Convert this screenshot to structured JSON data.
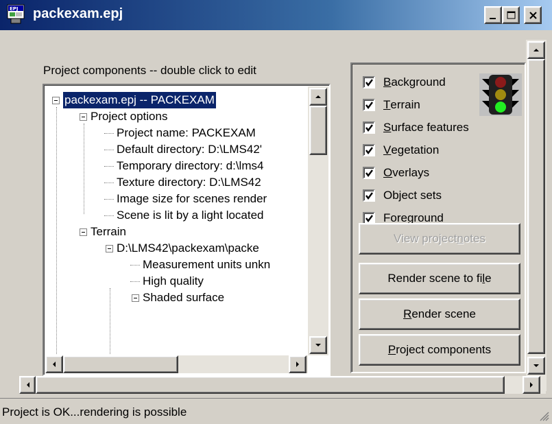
{
  "window": {
    "title": "packexam.epj",
    "icon": "epj-document-icon"
  },
  "tree": {
    "caption": "Project components -- double click to edit",
    "nodes": [
      {
        "label": "packexam.epj -- PACKEXAM",
        "level": 0,
        "expanded": true,
        "selected": true
      },
      {
        "label": "Project options",
        "level": 1,
        "expanded": true
      },
      {
        "label": "Project name: PACKEXAM",
        "level": 2
      },
      {
        "label": "Default directory: D:\\LMS42'",
        "level": 2
      },
      {
        "label": "Temporary directory: d:\\lms4",
        "level": 2
      },
      {
        "label": "Texture directory: D:\\LMS42",
        "level": 2
      },
      {
        "label": "Image size for scenes render",
        "level": 2
      },
      {
        "label": "Scene is lit by a light located",
        "level": 2
      },
      {
        "label": "Terrain",
        "level": 1,
        "expanded": true
      },
      {
        "label": "D:\\LMS42\\packexam\\packe",
        "level": 2,
        "expanded": true
      },
      {
        "label": "Measurement units unkn",
        "level": 3
      },
      {
        "label": "High quality",
        "level": 3
      },
      {
        "label": "Shaded surface",
        "level": 3,
        "expanded": true
      }
    ]
  },
  "layers": {
    "items": [
      {
        "pre": "",
        "accel": "B",
        "post": "ackground",
        "checked": true
      },
      {
        "pre": "",
        "accel": "T",
        "post": "errain",
        "checked": true
      },
      {
        "pre": "",
        "accel": "S",
        "post": "urface features",
        "checked": true
      },
      {
        "pre": "",
        "accel": "V",
        "post": "egetation",
        "checked": true
      },
      {
        "pre": "",
        "accel": "O",
        "post": "verlays",
        "checked": true
      },
      {
        "pre": "Object sets",
        "accel": "",
        "post": "",
        "checked": true
      },
      {
        "pre": "Foreground",
        "accel": "",
        "post": "",
        "checked": true
      }
    ]
  },
  "buttons": {
    "view_notes": {
      "pre": "View project ",
      "accel": "n",
      "post": "otes",
      "enabled": false
    },
    "render_to_file": {
      "pre": "Render scene to fi",
      "accel": "l",
      "post": "e",
      "enabled": true
    },
    "render_scene": {
      "pre": "",
      "accel": "R",
      "post": "ender scene",
      "enabled": true
    },
    "project_components": {
      "pre": "",
      "accel": "P",
      "post": "roject components",
      "enabled": true
    }
  },
  "status": {
    "text": "Project is OK...rendering is possible"
  },
  "colors": {
    "titlebar_start": "#0a246a",
    "titlebar_end": "#a6caf0",
    "face": "#d4d0c8",
    "selection": "#0a246a",
    "traffic_red": "#8b1a1a",
    "traffic_yellow": "#a08a10",
    "traffic_green": "#22ee22"
  }
}
